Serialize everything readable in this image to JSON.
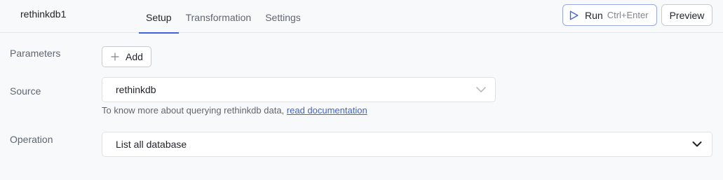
{
  "header": {
    "query_name": "rethinkdb1",
    "tabs": [
      {
        "label": "Setup",
        "active": true
      },
      {
        "label": "Transformation",
        "active": false
      },
      {
        "label": "Settings",
        "active": false
      }
    ],
    "run_button": {
      "label": "Run",
      "shortcut": "Ctrl+Enter",
      "icon": "play-icon"
    },
    "preview_button": {
      "label": "Preview"
    }
  },
  "form": {
    "parameters": {
      "label": "Parameters",
      "add_button": {
        "label": "Add",
        "icon": "plus-icon"
      }
    },
    "source": {
      "label": "Source",
      "value": "rethinkdb",
      "hint_text": "To know more about querying rethinkdb data, ",
      "hint_link": "read documentation"
    },
    "operation": {
      "label": "Operation",
      "value": "List all database"
    }
  },
  "colors": {
    "accent": "#3e63dd",
    "background": "#f8f9fa",
    "border": "#dfe3e6"
  }
}
